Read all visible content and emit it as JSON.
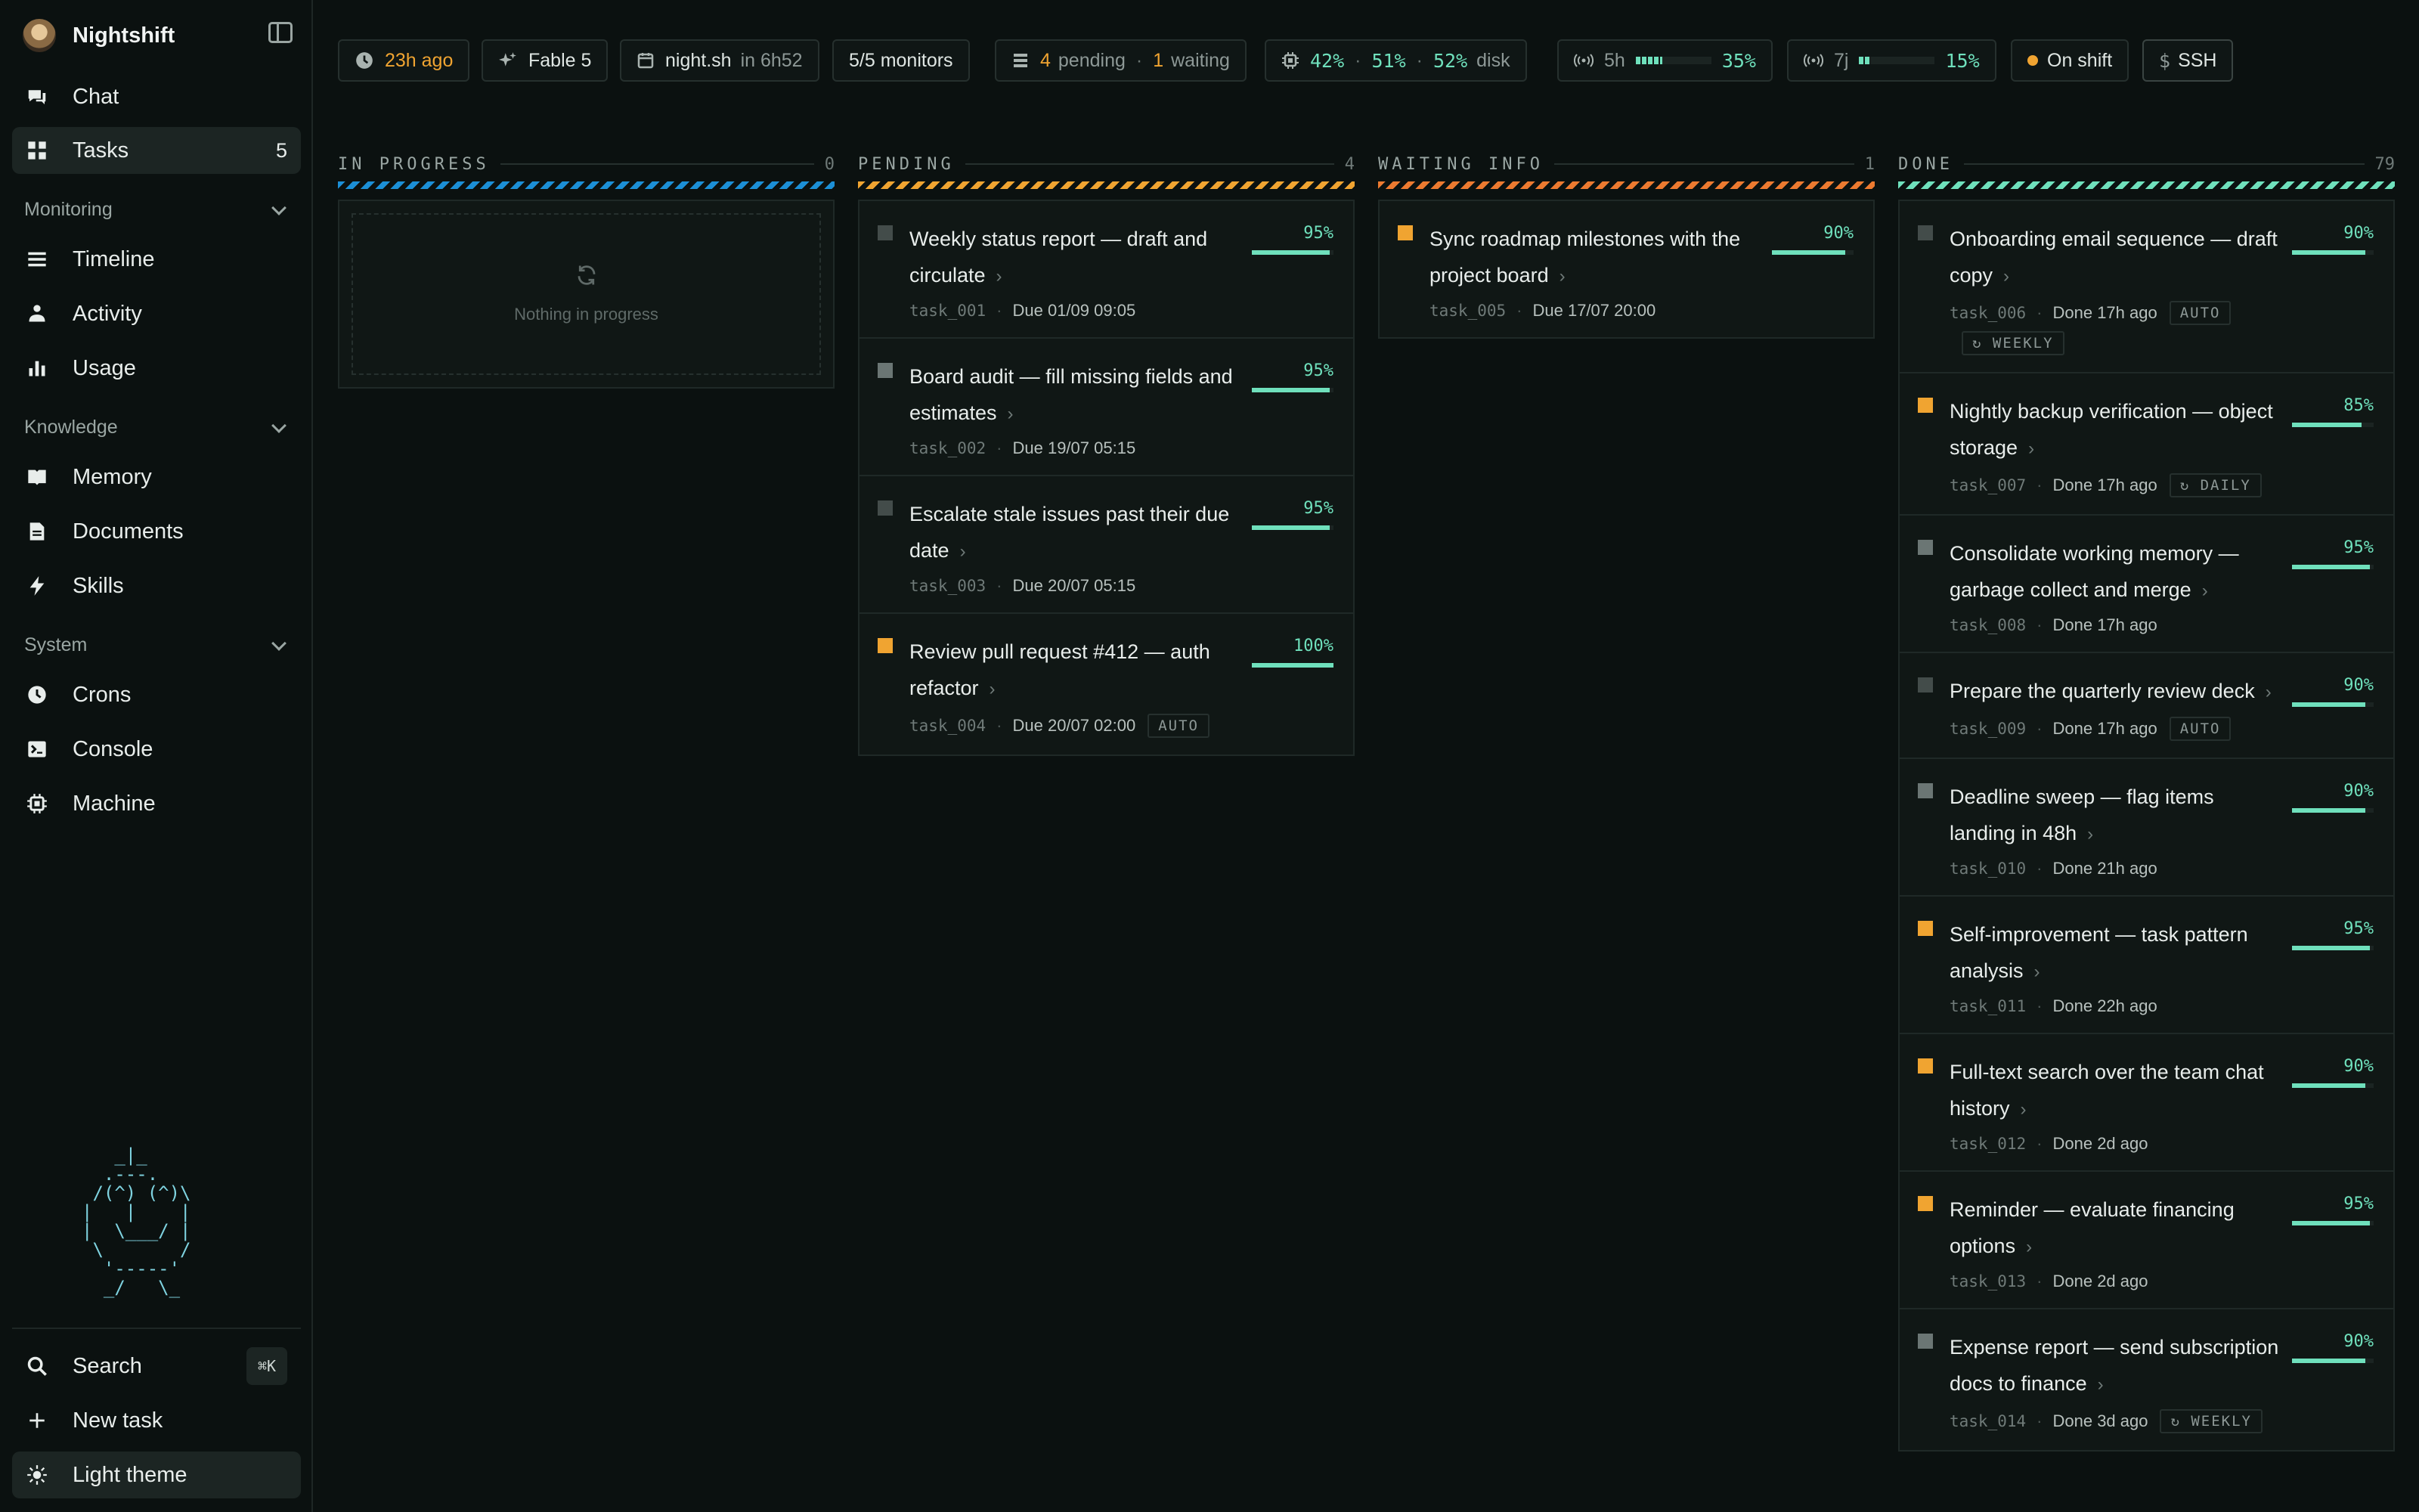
{
  "app": {
    "name": "Nightshift"
  },
  "sidebar": {
    "top": [
      {
        "label": "Chat",
        "icon": "chat-icon"
      },
      {
        "label": "Tasks",
        "icon": "grid-icon",
        "badge": "5",
        "active": true
      }
    ],
    "sections": [
      {
        "title": "Monitoring",
        "items": [
          "Timeline",
          "Activity",
          "Usage"
        ]
      },
      {
        "title": "Knowledge",
        "items": [
          "Memory",
          "Documents",
          "Skills"
        ]
      },
      {
        "title": "System",
        "items": [
          "Crons",
          "Console",
          "Machine"
        ]
      }
    ],
    "mascot": "   _|_\n  .---.\n /(^) (^)\\\n|   |    |\n|  \\___/ |\n \\       /\n  '-----'\n  _/   \\_",
    "bottom": {
      "search_label": "Search",
      "search_shortcut": "⌘K",
      "new_task_label": "New task",
      "theme_label": "Light theme"
    }
  },
  "topbar": {
    "last_sync": "23h ago",
    "model": "Fable 5",
    "host": "night.sh",
    "host_eta": "in 6h52",
    "monitors": "5/5 monitors",
    "queue": {
      "pending_count": "4",
      "pending_label": "pending",
      "waiting_count": "1",
      "waiting_label": "waiting"
    },
    "resources": {
      "cpu": "42%",
      "mem": "51%",
      "disk": "52%",
      "disk_label": "disk"
    },
    "quota_5h": {
      "label": "5h",
      "value": "35%",
      "fraction": 0.35
    },
    "quota_7j": {
      "label": "7j",
      "value": "15%",
      "fraction": 0.15
    },
    "shift_status": "On shift",
    "ssh_label": "SSH",
    "ssh_prefix": "$"
  },
  "board": {
    "columns": [
      {
        "title": "IN PROGRESS",
        "count": "0",
        "stripe": "blue",
        "empty_text": "Nothing in progress",
        "cards": []
      },
      {
        "title": "PENDING",
        "count": "4",
        "stripe": "amber",
        "cards": [
          {
            "title": "Weekly status report — draft and circulate",
            "id": "task_001",
            "when": "Due 01/09 09:05",
            "pct": "95%",
            "fraction": 0.95,
            "marker": "dark",
            "tags": []
          },
          {
            "title": "Board audit — fill missing fields and estimates",
            "id": "task_002",
            "when": "Due 19/07 05:15",
            "pct": "95%",
            "fraction": 0.95,
            "marker": "gray",
            "tags": []
          },
          {
            "title": "Escalate stale issues past their due date",
            "id": "task_003",
            "when": "Due 20/07 05:15",
            "pct": "95%",
            "fraction": 0.95,
            "marker": "dark",
            "tags": []
          },
          {
            "title": "Review pull request #412 — auth refactor",
            "id": "task_004",
            "when": "Due 20/07 02:00",
            "pct": "100%",
            "fraction": 1.0,
            "marker": "amber",
            "tags": [
              "AUTO"
            ]
          }
        ]
      },
      {
        "title": "WAITING INFO",
        "count": "1",
        "stripe": "orange2",
        "cards": [
          {
            "title": "Sync roadmap milestones with the project board",
            "id": "task_005",
            "when": "Due 17/07 20:00",
            "pct": "90%",
            "fraction": 0.9,
            "marker": "amber",
            "tags": []
          }
        ]
      },
      {
        "title": "DONE",
        "count": "79",
        "stripe": "teal",
        "cards": [
          {
            "title": "Onboarding email sequence — draft copy",
            "id": "task_006",
            "when": "Done 17h ago",
            "pct": "90%",
            "fraction": 0.9,
            "marker": "dark",
            "tags": [
              "AUTO",
              "↻ WEEKLY"
            ]
          },
          {
            "title": "Nightly backup verification — object storage",
            "id": "task_007",
            "when": "Done 17h ago",
            "pct": "85%",
            "fraction": 0.85,
            "marker": "amber",
            "tags": [
              "↻ DAILY"
            ]
          },
          {
            "title": "Consolidate working memory — garbage collect and merge",
            "id": "task_008",
            "when": "Done 17h ago",
            "pct": "95%",
            "fraction": 0.95,
            "marker": "gray",
            "tags": []
          },
          {
            "title": "Prepare the quarterly review deck",
            "id": "task_009",
            "when": "Done 17h ago",
            "pct": "90%",
            "fraction": 0.9,
            "marker": "dark",
            "tags": [
              "AUTO"
            ]
          },
          {
            "title": "Deadline sweep — flag items landing in 48h",
            "id": "task_010",
            "when": "Done 21h ago",
            "pct": "90%",
            "fraction": 0.9,
            "marker": "gray",
            "tags": []
          },
          {
            "title": "Self-improvement — task pattern analysis",
            "id": "task_011",
            "when": "Done 22h ago",
            "pct": "95%",
            "fraction": 0.95,
            "marker": "amber",
            "tags": []
          },
          {
            "title": "Full-text search over the team chat history",
            "id": "task_012",
            "when": "Done 2d ago",
            "pct": "90%",
            "fraction": 0.9,
            "marker": "amber",
            "tags": []
          },
          {
            "title": "Reminder — evaluate financing options",
            "id": "task_013",
            "when": "Done 2d ago",
            "pct": "95%",
            "fraction": 0.95,
            "marker": "amber",
            "tags": []
          },
          {
            "title": "Expense report — send subscription docs to finance",
            "id": "task_014",
            "when": "Done 3d ago",
            "pct": "90%",
            "fraction": 0.9,
            "marker": "gray",
            "tags": [
              "↻ WEEKLY"
            ]
          }
        ]
      }
    ]
  }
}
